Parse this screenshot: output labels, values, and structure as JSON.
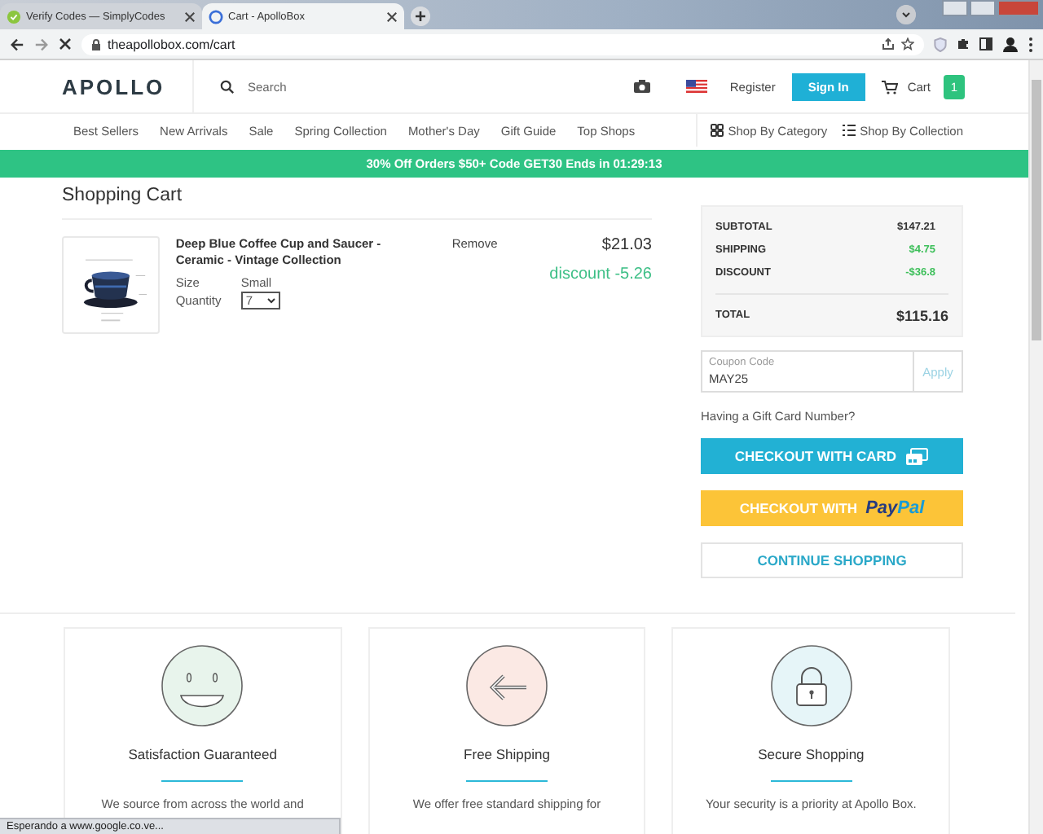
{
  "browser": {
    "tabs": [
      {
        "title": "Verify Codes — SimplyCodes",
        "selected": false
      },
      {
        "title": "Cart - ApolloBox",
        "selected": true
      }
    ],
    "url": "theapollobox.com/cart"
  },
  "header": {
    "logo": "APOLLO",
    "search_placeholder": "Search",
    "register": "Register",
    "sign_in": "Sign In",
    "cart": "Cart",
    "cart_count": "1"
  },
  "nav": {
    "items": [
      "Best Sellers",
      "New Arrivals",
      "Sale",
      "Spring Collection",
      "Mother's Day",
      "Gift Guide",
      "Top Shops"
    ],
    "shop_by_category": "Shop By Category",
    "shop_by_collection": "Shop By Collection"
  },
  "promo": "30% Off Orders $50+ Code GET30 Ends in 01:29:13",
  "cart": {
    "title": "Shopping Cart",
    "items": [
      {
        "name": "Deep Blue Coffee Cup and Saucer - Ceramic - Vintage Collection",
        "size_label": "Size",
        "size": "Small",
        "quantity_label": "Quantity",
        "quantity": "7",
        "remove": "Remove",
        "price": "$21.03",
        "discount": "discount -5.26"
      }
    ]
  },
  "summary": {
    "rows": [
      {
        "label": "SUBTOTAL",
        "value": "$147.21",
        "kind": "plain"
      },
      {
        "label": "SHIPPING",
        "value": "$4.75",
        "kind": "positive"
      },
      {
        "label": "DISCOUNT",
        "value": "-$36.8",
        "kind": "positive"
      }
    ],
    "total_label": "TOTAL",
    "total": "$115.16"
  },
  "coupon": {
    "label": "Coupon Code",
    "value": "MAY25",
    "apply": "Apply"
  },
  "gift_card": "Having a Gift Card Number?",
  "checkout_card": "CHECKOUT WITH CARD",
  "checkout_paypal": "CHECKOUT WITH",
  "paypal_pay": "Pay",
  "paypal_pal": "Pal",
  "continue": "CONTINUE SHOPPING",
  "features": [
    {
      "kind": "smile",
      "color": "#e8f4ec",
      "title": "Satisfaction Guaranteed",
      "text": "We source from across the world and"
    },
    {
      "kind": "arrow",
      "color": "#fbe9e4",
      "title": "Free Shipping",
      "text": "We offer free standard shipping for"
    },
    {
      "kind": "lock",
      "color": "#e6f5f8",
      "title": "Secure Shopping",
      "text": "Your security is a priority at Apollo Box."
    }
  ],
  "status": "Esperando a www.google.co.ve..."
}
